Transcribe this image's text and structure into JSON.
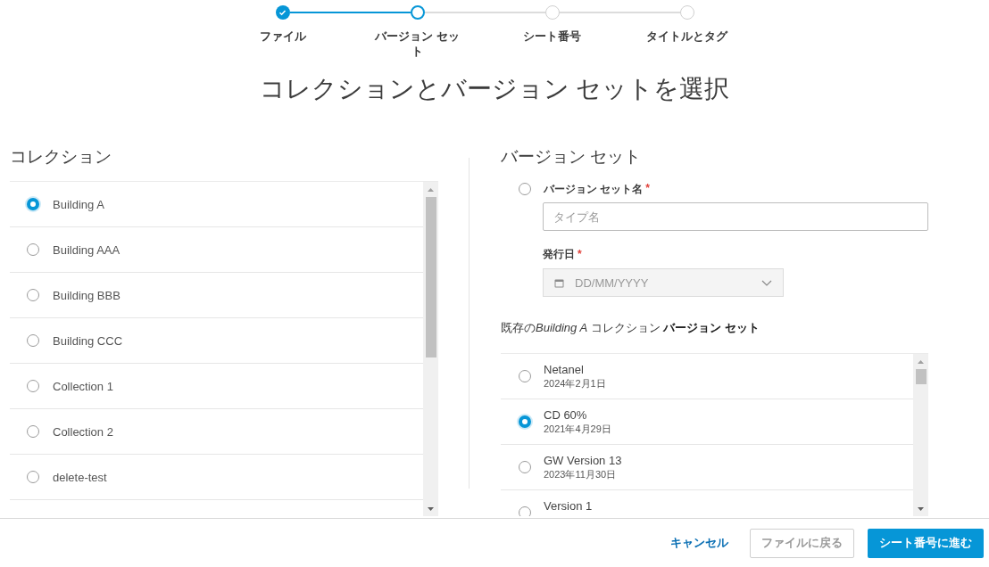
{
  "steps": [
    {
      "label": "ファイル",
      "completed": true,
      "selected": false
    },
    {
      "label": "バージョン セット",
      "completed": false,
      "selected": true
    },
    {
      "label": "シート番号",
      "completed": false,
      "selected": false
    },
    {
      "label": "タイトルとタグ",
      "completed": false,
      "selected": false
    }
  ],
  "title": "コレクションとバージョン セットを選択",
  "collections": {
    "heading": "コレクション",
    "items": [
      {
        "label": "Building A",
        "selected": true
      },
      {
        "label": "Building AAA",
        "selected": false
      },
      {
        "label": "Building BBB",
        "selected": false
      },
      {
        "label": "Building CCC",
        "selected": false
      },
      {
        "label": "Collection 1",
        "selected": false
      },
      {
        "label": "Collection 2",
        "selected": false
      },
      {
        "label": "delete-test",
        "selected": false
      }
    ]
  },
  "version_set": {
    "heading": "バージョン セット",
    "new_option": {
      "selected": false,
      "name_label": "バージョン セット名",
      "name_required": "*",
      "name_placeholder": "タイプ名",
      "date_label": "発行日",
      "date_required": "*",
      "date_placeholder": "DD/MM/YYYY"
    },
    "existing_caption": [
      {
        "text": "既存の",
        "kind": "plain"
      },
      {
        "text": "Building A",
        "kind": "emphasis"
      },
      {
        "text": " コレクション ",
        "kind": "plain"
      },
      {
        "text": "バージョン セット",
        "kind": "strong"
      }
    ],
    "existing": [
      {
        "name": "Netanel",
        "date": "2024年2月1日",
        "selected": false
      },
      {
        "name": "CD 60%",
        "date": "2021年4月29日",
        "selected": true
      },
      {
        "name": "GW Version 13",
        "date": "2023年11月30日",
        "selected": false
      },
      {
        "name": "Version 1",
        "selected": false
      }
    ]
  },
  "footer": {
    "cancel": "キャンセル",
    "back": {
      "label": "ファイルに戻る",
      "disabled": true
    },
    "next": "シート番号に進む"
  }
}
